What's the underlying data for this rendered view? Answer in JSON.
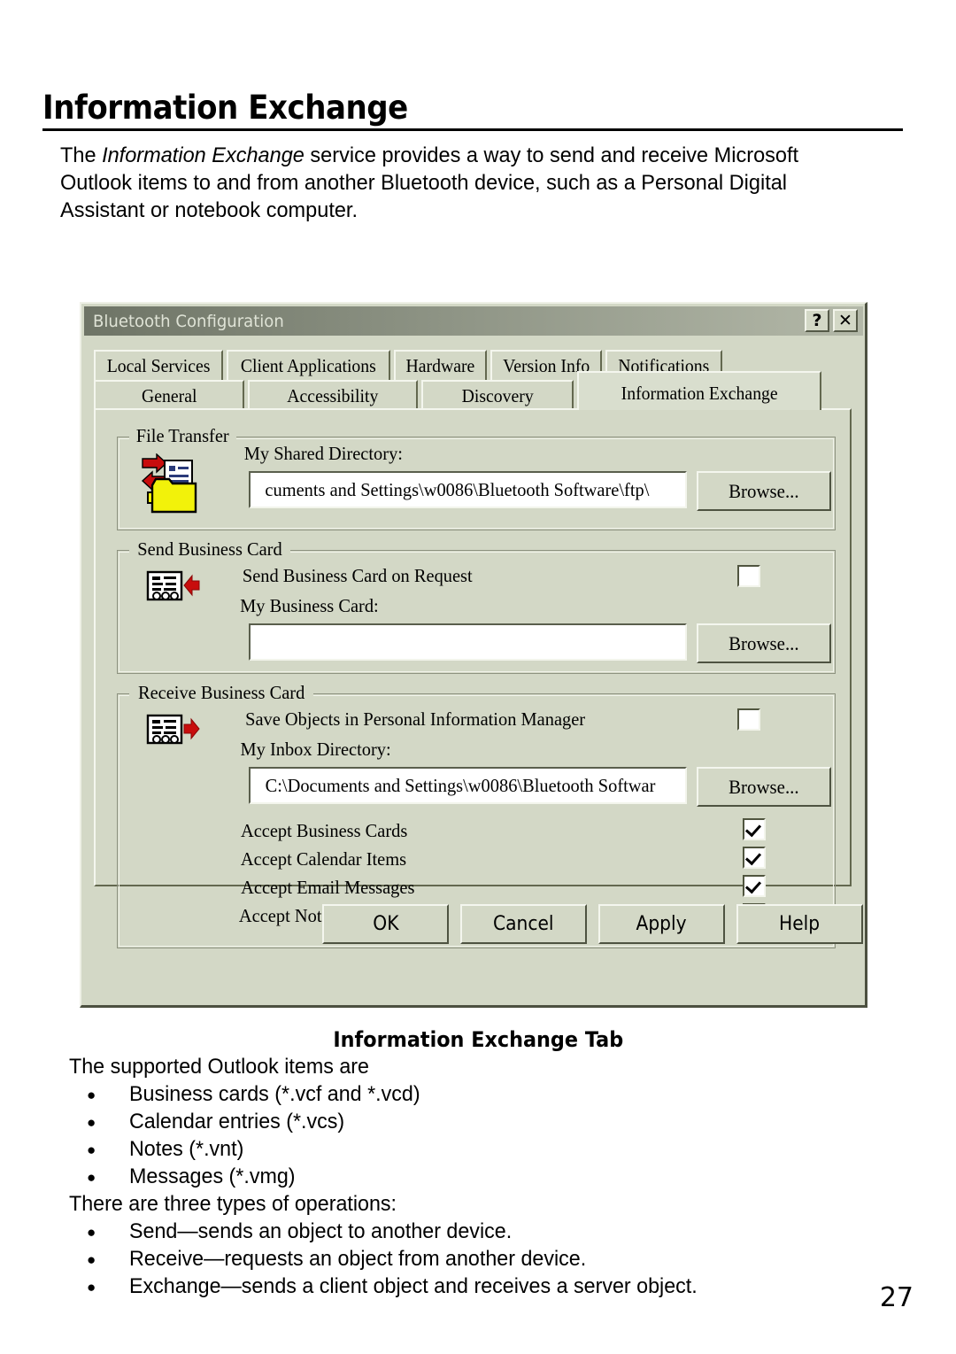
{
  "page": {
    "heading": "Information Exchange",
    "intro_pre": "The ",
    "intro_italic": "Information Exchange",
    "intro_post": " service provides a way to send and receive Microsoft Outlook items to and from another Bluetooth device, such as a Personal Digital Assistant or notebook computer.",
    "figure_caption": "Information Exchange Tab",
    "supported_intro": "The supported Outlook items are",
    "supported_items": [
      "Business cards (*.vcf and *.vcd)",
      "Calendar entries (*.vcs)",
      "Notes (*.vnt)",
      "Messages (*.vmg)"
    ],
    "operations_intro": "There are three types of operations:",
    "operations": [
      "Send—sends an object to another device.",
      "Receive—requests an object from another device.",
      "Exchange—sends a client object and receives a server object."
    ],
    "page_number": "27"
  },
  "dialog": {
    "title": "Bluetooth Configuration",
    "help_button": "?",
    "close_button": "✕",
    "tabs_row1": [
      {
        "label": "Local Services",
        "selected": false
      },
      {
        "label": "Client Applications",
        "selected": false
      },
      {
        "label": "Hardware",
        "selected": false
      },
      {
        "label": "Version Info",
        "selected": false
      },
      {
        "label": "Notifications",
        "selected": false
      }
    ],
    "tabs_row2": [
      {
        "label": "General",
        "selected": false
      },
      {
        "label": "Accessibility",
        "selected": false
      },
      {
        "label": "Discovery",
        "selected": false
      },
      {
        "label": "Information Exchange",
        "selected": true
      }
    ],
    "file_transfer": {
      "group_title": "File Transfer",
      "shared_dir_label": "My Shared Directory:",
      "shared_dir_value": "cuments and Settings\\w0086\\Bluetooth Software\\ftp\\",
      "browse_label": "Browse...",
      "icon": "folder-transfer-icon"
    },
    "send_business_card": {
      "group_title": "Send Business Card",
      "on_request_label": "Send Business Card on Request",
      "on_request_checked": false,
      "my_card_label": "My Business Card:",
      "my_card_value": "",
      "browse_label": "Browse...",
      "icon": "business-card-send-icon"
    },
    "receive_business_card": {
      "group_title": "Receive Business Card",
      "save_pim_label": "Save Objects in Personal Information Manager",
      "save_pim_checked": false,
      "inbox_label": "My Inbox Directory:",
      "inbox_value": "C:\\Documents and Settings\\w0086\\Bluetooth Softwar",
      "browse_label": "Browse...",
      "icon": "business-card-receive-icon",
      "accept_options": [
        {
          "label": "Accept Business Cards",
          "checked": true
        },
        {
          "label": "Accept Calendar Items",
          "checked": true
        },
        {
          "label": "Accept Email Messages",
          "checked": true
        },
        {
          "label": "Accept Notes",
          "checked": true
        }
      ]
    },
    "buttons": [
      {
        "label": "OK"
      },
      {
        "label": "Cancel"
      },
      {
        "label": "Apply"
      },
      {
        "label": "Help"
      }
    ]
  },
  "colors": {
    "dialog_face": "#d3d8c6",
    "titlebar_dark": "#6e7466",
    "icon_folder": "#f2f20a",
    "icon_arrow_red": "#c80d0d"
  }
}
